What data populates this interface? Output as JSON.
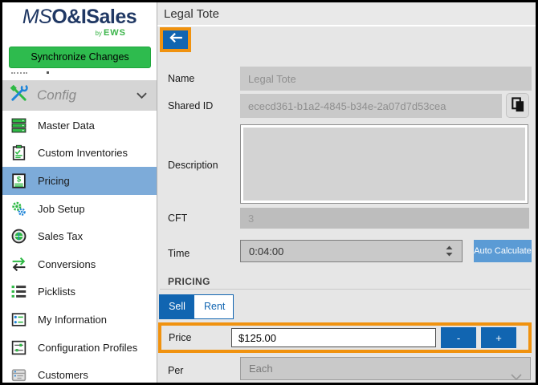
{
  "window": {
    "title": "Legal Tote"
  },
  "colors": {
    "accent_blue": "#1165b1",
    "light_blue_button": "#5b9bd5",
    "selected_nav_blue": "#7dabd9",
    "brand_green": "#2ebb4e",
    "logo_navy": "#203864",
    "annotation_orange": "#f0920f",
    "main_background": "#e6e6e6",
    "input_gray": "#c9c9c9"
  },
  "sidebar": {
    "logo": {
      "ms": "MS",
      "rest": "O&ISales",
      "by": "by",
      "brand": "EWS"
    },
    "sync_button_label": "Synchronize Changes",
    "section": {
      "label": "Config",
      "icon": "tools-icon",
      "chevron": "chevron-down-icon"
    },
    "items": [
      {
        "label": "Master Data",
        "icon": "server-stack-icon",
        "selected": false
      },
      {
        "label": "Custom Inventories",
        "icon": "clipboard-icon",
        "selected": false
      },
      {
        "label": "Pricing",
        "icon": "price-ledger-icon",
        "selected": true
      },
      {
        "label": "Job Setup",
        "icon": "gears-icon",
        "selected": false
      },
      {
        "label": "Sales Tax",
        "icon": "coin-icon",
        "selected": false
      },
      {
        "label": "Conversions",
        "icon": "swap-arrows-icon",
        "selected": false
      },
      {
        "label": "Picklists",
        "icon": "bullet-list-icon",
        "selected": false
      },
      {
        "label": "My Information",
        "icon": "info-card-icon",
        "selected": false
      },
      {
        "label": "Configuration Profiles",
        "icon": "sliders-icon",
        "selected": false
      },
      {
        "label": "Customers",
        "icon": "customer-card-icon",
        "selected": false
      }
    ]
  },
  "main": {
    "title": "Legal Tote",
    "back_button_icon": "arrow-left-icon",
    "fields": {
      "name": {
        "label": "Name",
        "value": "Legal Tote"
      },
      "shared_id": {
        "label": "Shared ID",
        "value": "ececd361-b1a2-4845-b34e-2a07d7d53cea",
        "copy_icon": "copy-icon"
      },
      "description": {
        "label": "Description",
        "value": ""
      },
      "cft": {
        "label": "CFT",
        "value": "3"
      },
      "time": {
        "label": "Time",
        "value": "0:04:00",
        "auto_button_label": "Auto Calculate"
      }
    },
    "pricing": {
      "section_title": "PRICING",
      "tabs": [
        {
          "label": "Sell",
          "active": true
        },
        {
          "label": "Rent",
          "active": false
        }
      ],
      "price": {
        "label": "Price",
        "value": "$125.00",
        "minus_label": "-",
        "plus_label": "+"
      },
      "per": {
        "label": "Per",
        "value": "Each"
      }
    }
  }
}
